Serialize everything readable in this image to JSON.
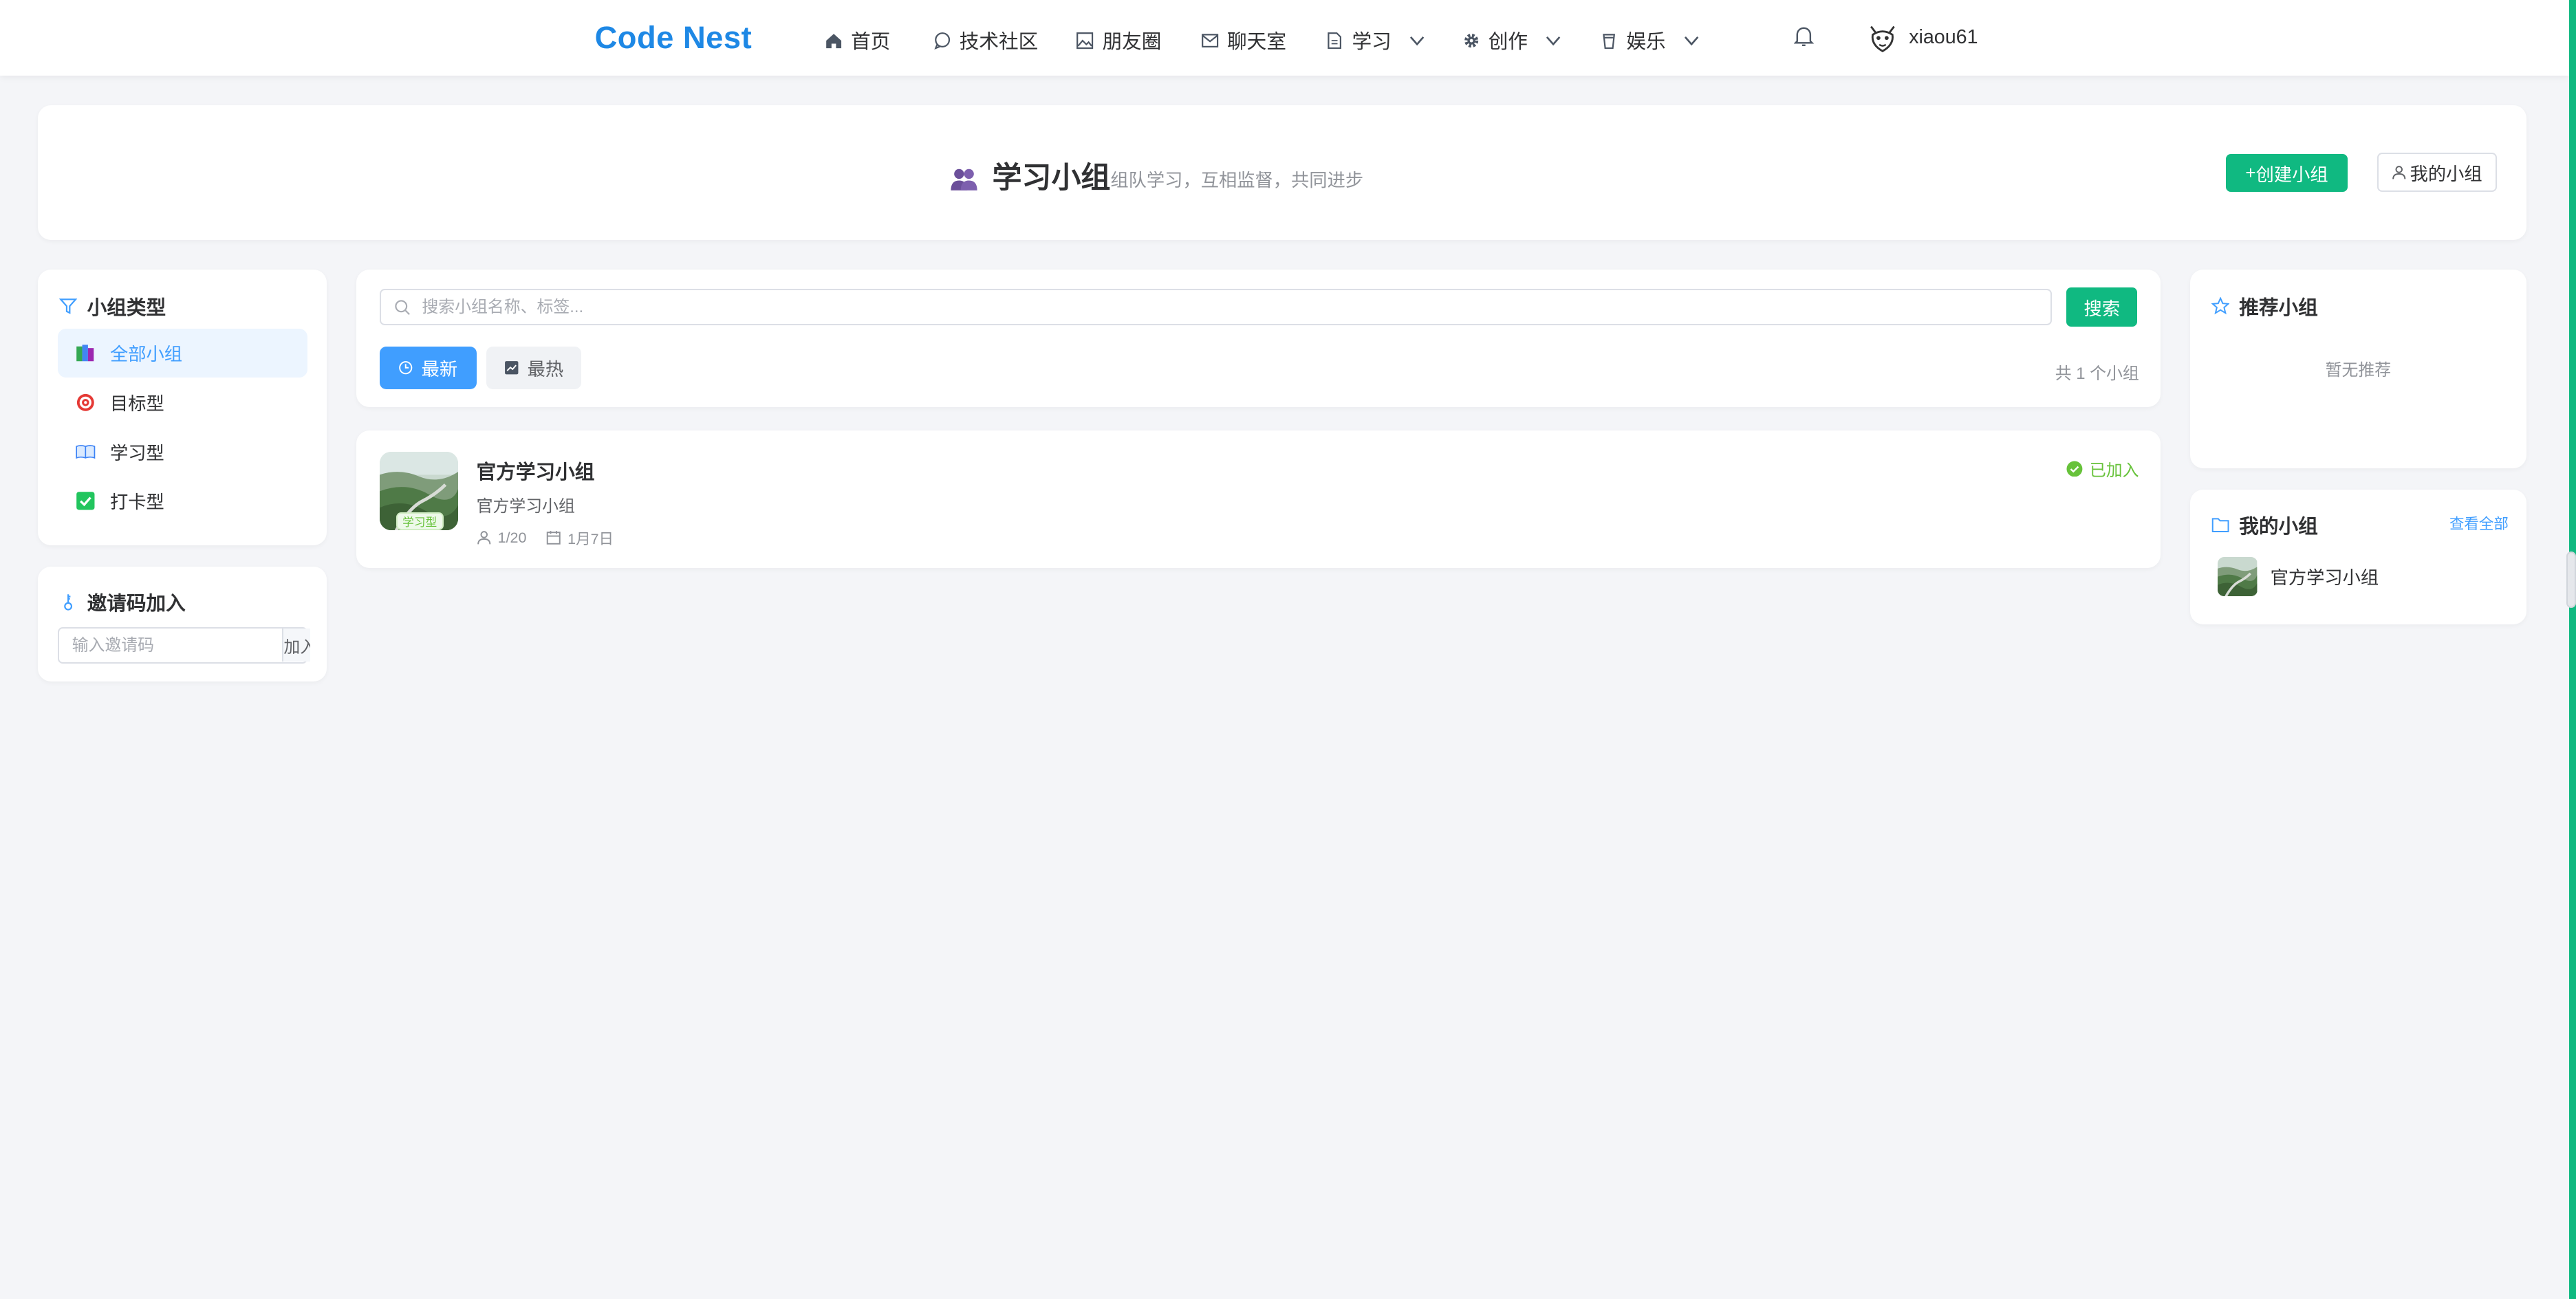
{
  "nav": {
    "logo": "Code Nest",
    "items": [
      {
        "label": "首页",
        "icon": "home-icon"
      },
      {
        "label": "技术社区",
        "icon": "chat-icon"
      },
      {
        "label": "朋友圈",
        "icon": "image-icon"
      },
      {
        "label": "聊天室",
        "icon": "mail-icon"
      },
      {
        "label": "学习",
        "icon": "document-icon",
        "dropdown": true
      },
      {
        "label": "创作",
        "icon": "gear-icon",
        "dropdown": true
      },
      {
        "label": "娱乐",
        "icon": "cup-icon",
        "dropdown": true
      }
    ],
    "username": "xiaou61"
  },
  "header": {
    "title": "学习小组",
    "subtitle": "组队学习，互相监督，共同进步",
    "create_button": "创建小组",
    "my_groups_button": "我的小组"
  },
  "sidebar": {
    "types_title": "小组类型",
    "types": [
      {
        "label": "全部小组",
        "icon": "books-icon",
        "active": true
      },
      {
        "label": "目标型",
        "icon": "target-icon"
      },
      {
        "label": "学习型",
        "icon": "open-book-icon"
      },
      {
        "label": "打卡型",
        "icon": "checkbox-icon"
      }
    ],
    "invite_title": "邀请码加入",
    "invite_placeholder": "输入邀请码",
    "invite_button": "加入"
  },
  "search": {
    "placeholder": "搜索小组名称、标签...",
    "button": "搜索",
    "sort_newest": "最新",
    "sort_hot": "最热",
    "total_text": "共 1 个小组"
  },
  "groups": [
    {
      "name": "官方学习小组",
      "description": "官方学习小组",
      "tag": "学习型",
      "members": "1/20",
      "date": "1月7日",
      "status": "已加入"
    }
  ],
  "recommend": {
    "title": "推荐小组",
    "empty": "暂无推荐"
  },
  "my_groups": {
    "title": "我的小组",
    "view_all": "查看全部",
    "items": [
      {
        "name": "官方学习小组"
      }
    ]
  },
  "colors": {
    "brand_blue": "#1e88e5",
    "primary_green": "#10b981",
    "active_blue": "#409eff",
    "success_green": "#67c23a"
  }
}
